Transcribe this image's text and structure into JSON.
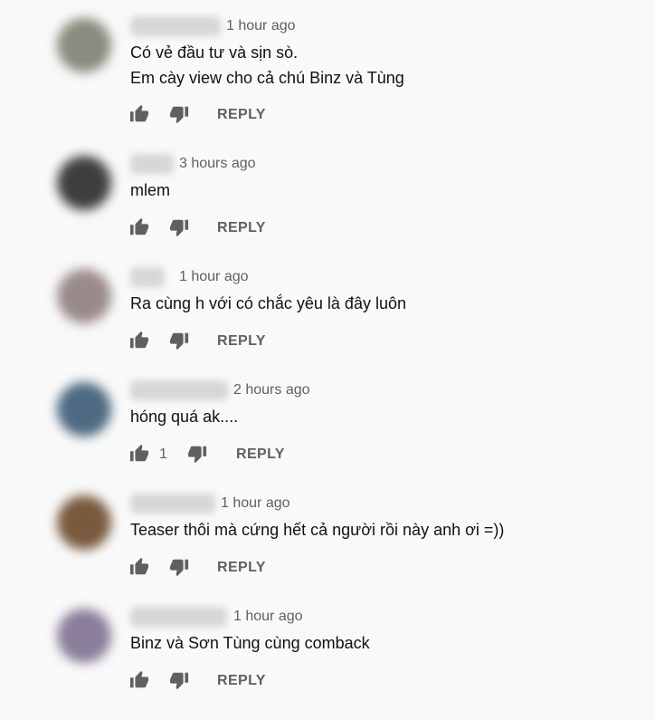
{
  "comments": [
    {
      "time": "1 hour ago",
      "text_lines": [
        "Có vẻ đầu tư và sịn sò.",
        "Em cày view cho cả chú Binz và Tùng"
      ],
      "likes": "",
      "reply_label": "REPLY",
      "avatar_color": "#8a8a7e"
    },
    {
      "time": "3 hours ago",
      "text_lines": [
        "mlem"
      ],
      "likes": "",
      "reply_label": "REPLY",
      "avatar_color": "#3e3e3e"
    },
    {
      "time": "1 hour ago",
      "text_lines": [
        "Ra cùng h với có chắc yêu là đây luôn"
      ],
      "likes": "",
      "reply_label": "REPLY",
      "avatar_color": "#9a8a8a"
    },
    {
      "time": "2 hours ago",
      "text_lines": [
        "hóng quá ak...."
      ],
      "likes": "1",
      "reply_label": "REPLY",
      "avatar_color": "#4d6a82"
    },
    {
      "time": "1 hour ago",
      "text_lines": [
        "Teaser thôi mà cứng hết cả người rồi này anh ơi =))"
      ],
      "likes": "",
      "reply_label": "REPLY",
      "avatar_color": "#7a5a3e"
    },
    {
      "time": "1 hour ago",
      "text_lines": [
        "Binz và Sơn Tùng cùng comback"
      ],
      "likes": "",
      "reply_label": "REPLY",
      "avatar_color": "#8a7e9a"
    }
  ]
}
